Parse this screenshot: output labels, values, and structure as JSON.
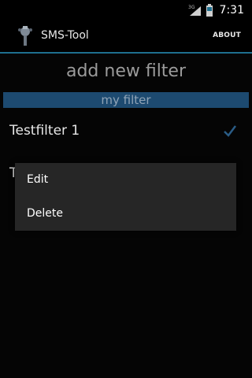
{
  "status_bar": {
    "network_label": "3G",
    "time": "7:31"
  },
  "action_bar": {
    "title": "SMS-Tool",
    "about_label": "ABOUT",
    "accent_color": "#1e6f8f"
  },
  "list": {
    "add_label": "add new filter",
    "section_header": "my filter",
    "section_header_color": "#1d4a70",
    "filters": [
      {
        "name": "Testfilter 1",
        "checked": true
      },
      {
        "name": "T",
        "checked": false
      }
    ]
  },
  "context_menu": {
    "items": [
      {
        "label": "Edit"
      },
      {
        "label": "Delete"
      }
    ]
  }
}
